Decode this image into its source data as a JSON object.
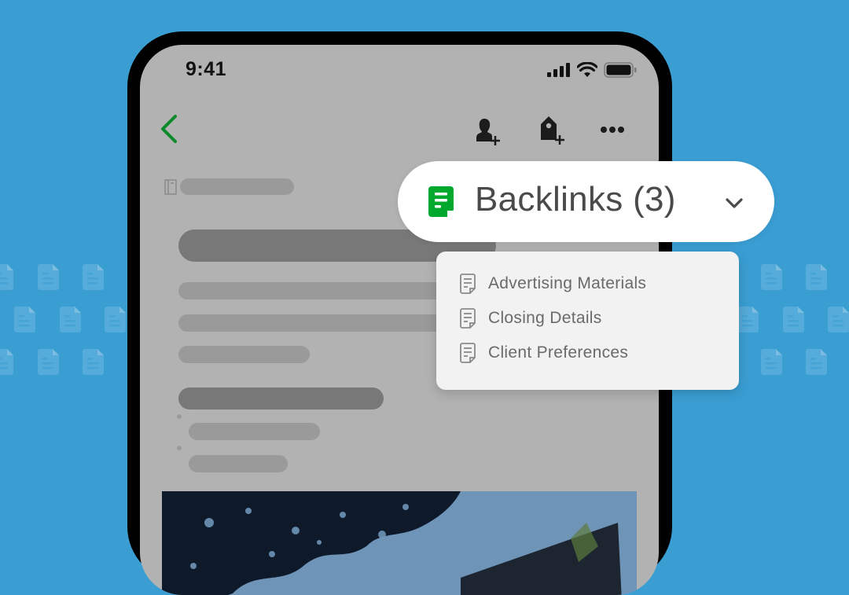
{
  "colors": {
    "background": "#3a9ed3",
    "accent_green": "#00a82d",
    "screen_dim": "#b2b2b2"
  },
  "status_bar": {
    "time": "9:41",
    "icons": [
      "cellular-signal-icon",
      "wifi-icon",
      "battery-icon"
    ]
  },
  "toolbar": {
    "back_icon": "chevron-left-icon",
    "actions": [
      "share-user-icon",
      "add-tag-icon",
      "more-icon"
    ]
  },
  "note": {
    "notebook_icon": "notebook-icon"
  },
  "backlinks": {
    "label": "Backlinks (3)",
    "icon": "note-icon",
    "chevron": "chevron-down-icon",
    "items": [
      {
        "label": "Advertising Materials",
        "icon": "note-icon"
      },
      {
        "label": "Closing Details",
        "icon": "note-icon"
      },
      {
        "label": "Client Preferences",
        "icon": "note-icon"
      }
    ]
  }
}
